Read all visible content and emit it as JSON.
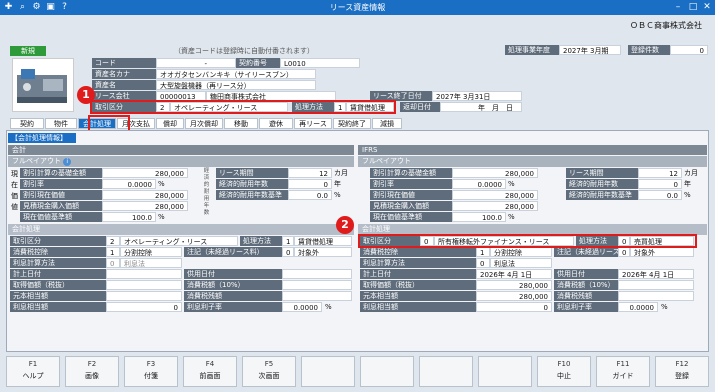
{
  "window": {
    "title": "リース資産情報",
    "company": "ＯＢＣ商事株式会社"
  },
  "badges": {
    "b1": "1",
    "b2": "2"
  },
  "header": {
    "new_label": "新規",
    "note": "（資産コードは登録時に自動付番されます）",
    "fiscal_label": "処理事業年度",
    "fiscal_value": "2027年 3月期",
    "count_label": "登録件数",
    "count_value": "0"
  },
  "asset": {
    "code_label": "コード",
    "code_value": "-",
    "contract_no_label": "契約番号",
    "contract_no_value": "L0010",
    "kana_label": "資産名カナ",
    "kana_value": "オオガタセンバンキキ（サイリースブン）",
    "name_label": "資産名",
    "name_value": "大型旋盤機器（再リース分）",
    "lessor_label": "リース会社",
    "lessor_code": "00000013",
    "lessor_name": "糖田商事株式会社",
    "lease_end_label": "リース終了日付",
    "lease_end_value": "2027年 3月31日",
    "trade_label": "取引区分",
    "trade_no": "2",
    "trade_value": "オペレーティング・リース",
    "method_label": "処理方法",
    "method_no": "1",
    "method_value": "賃貸借処理",
    "return_label": "返却日付",
    "return_value": "年　月　日"
  },
  "tabs": [
    "契約",
    "物件",
    "会計処理",
    "月次支払",
    "償却",
    "月次償却",
    "移動",
    "遊休",
    "再リース",
    "契約終了",
    "減損"
  ],
  "panel_title": "【会計処理情報】",
  "left": {
    "section": "会計",
    "fulllabel": "フルペイアウト",
    "vert1": [
      "現",
      "在",
      "価",
      "値"
    ],
    "vert2": "経済的耐用年数",
    "rows1": [
      {
        "l": "割引計算の基礎金額",
        "v": "280,000"
      },
      {
        "l": "割引率",
        "v": "0.0000",
        "u": "%"
      },
      {
        "l": "割引現在価値",
        "v": "280,000"
      },
      {
        "l": "見積現金購入価額",
        "v": "280,000"
      },
      {
        "l": "現在価値基準額",
        "v": "100.0",
        "u": "%"
      }
    ],
    "rows2": [
      {
        "l": "リース期間",
        "v": "12",
        "u": "カ月"
      },
      {
        "l": "経済的耐用年数",
        "v": "0",
        "u": "年"
      },
      {
        "l": "経済的耐用年数基準",
        "v": "0.0",
        "u": "%"
      }
    ],
    "proc": "会計処理",
    "trade_label": "取引区分",
    "trade_no": "2",
    "trade_value": "オペレーティング・リース",
    "method_label": "処理方法",
    "method_no": "1",
    "method_value": "賃貸借処理",
    "tax_label": "消費税控除",
    "tax_no": "1",
    "tax_value": "分割控除",
    "note_label": "注記（未経過リース料）",
    "note_no": "0",
    "note_value": "対象外",
    "interest_label": "利息計算方法",
    "interest_no": "0",
    "interest_value": "利息法",
    "cap_label": "計上日付",
    "use_label": "供用日付",
    "cost_label": "取得価額（税抜）",
    "taxr_label": "消費税額（10%）",
    "principal_label": "元本相当額",
    "taxt_label": "消費税残額",
    "int_label": "利息相当額",
    "intval": "0",
    "rate_label": "利息利子率",
    "rate_value": "0.0000",
    "rate_unit": "%"
  },
  "right": {
    "section": "IFRS",
    "fulllabel": "フルペイアウト",
    "rows1": [
      {
        "l": "割引計算の基礎金額",
        "v": "280,000"
      },
      {
        "l": "割引率",
        "v": "0.0000",
        "u": "%"
      },
      {
        "l": "割引現在価値",
        "v": "280,000"
      },
      {
        "l": "見積現金購入価額",
        "v": "280,000"
      },
      {
        "l": "現在価値基準額",
        "v": "100.0",
        "u": "%"
      }
    ],
    "rows2": [
      {
        "l": "リース期間",
        "v": "12",
        "u": "カ月"
      },
      {
        "l": "経済的耐用年数",
        "v": "0",
        "u": "年"
      },
      {
        "l": "経済的耐用年数基準",
        "v": "0.0",
        "u": "%"
      }
    ],
    "proc": "会計処理",
    "trade_label": "取引区分",
    "trade_no": "0",
    "trade_value": "所有権移転外ファイナンス・リース",
    "method_label": "処理方法",
    "method_no": "0",
    "method_value": "売買処理",
    "tax_label": "消費税控除",
    "tax_no": "1",
    "tax_value": "分割控除",
    "note_label": "注記（未経過リース料）",
    "note_no": "0",
    "note_value": "対象外",
    "interest_label": "利息計算方法",
    "interest_no": "0",
    "interest_value": "利息法",
    "cap_label": "計上日付",
    "cap_value": "2026年 4月 1日",
    "use_label": "供用日付",
    "use_value": "2026年 4月 1日",
    "cost_label": "取得価額（税抜）",
    "cost_value": "280,000",
    "taxr_label": "消費税額（10%）",
    "principal_label": "元本相当額",
    "principal_value": "280,000",
    "taxt_label": "消費税残額",
    "int_label": "利息相当額",
    "intval": "0",
    "rate_label": "利息利子率",
    "rate_value": "0.0000",
    "rate_unit": "%"
  },
  "fkeys": [
    {
      "k": "F1",
      "n": "ヘルプ"
    },
    {
      "k": "F2",
      "n": "画像"
    },
    {
      "k": "F3",
      "n": "付箋"
    },
    {
      "k": "F4",
      "n": "前画面"
    },
    {
      "k": "F5",
      "n": "次画面"
    },
    {
      "k": "",
      "n": ""
    },
    {
      "k": "",
      "n": ""
    },
    {
      "k": "",
      "n": ""
    },
    {
      "k": "",
      "n": ""
    },
    {
      "k": "F10",
      "n": "中止"
    },
    {
      "k": "F11",
      "n": "ガイド"
    },
    {
      "k": "F12",
      "n": "登録"
    }
  ]
}
